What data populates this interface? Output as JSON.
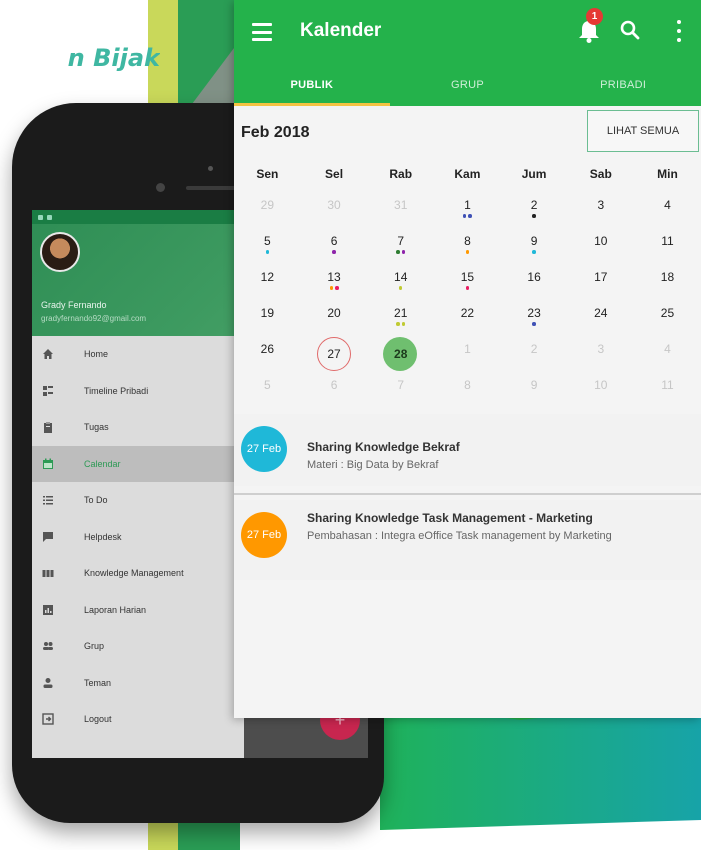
{
  "headline": "n Bijak",
  "colors": {
    "brand_green": "#24b24b",
    "tab_indicator": "#f5c342",
    "event_blue": "#1fb8d8",
    "event_orange": "#ff9800",
    "headline_teal": "#3fb7a2"
  },
  "phone": {
    "drawer": {
      "user_name": "Grady Fernando",
      "user_email": "gradyfernando92@gmail.com",
      "items": [
        {
          "label": "Home",
          "icon": "home-icon"
        },
        {
          "label": "Timeline Pribadi",
          "icon": "timeline-icon"
        },
        {
          "label": "Tugas",
          "icon": "clipboard-icon"
        },
        {
          "label": "Calendar",
          "icon": "calendar-icon",
          "active": true
        },
        {
          "label": "To Do",
          "icon": "checklist-icon"
        },
        {
          "label": "Helpdesk",
          "icon": "chat-icon"
        },
        {
          "label": "Knowledge Management",
          "icon": "books-icon"
        },
        {
          "label": "Laporan Harian",
          "icon": "report-icon"
        },
        {
          "label": "Grup",
          "icon": "group-icon"
        },
        {
          "label": "Teman",
          "icon": "person-icon"
        },
        {
          "label": "Logout",
          "icon": "logout-icon"
        }
      ]
    },
    "fab_symbol": "+"
  },
  "app": {
    "title": "Kalender",
    "notification_count": "1",
    "tabs": [
      {
        "label": "PUBLIK",
        "active": true
      },
      {
        "label": "GRUP",
        "active": false
      },
      {
        "label": "PRIBADI",
        "active": false
      }
    ],
    "month_label": "Feb 2018",
    "see_all_label": "LIHAT SEMUA",
    "weekdays": [
      "Sen",
      "Sel",
      "Rab",
      "Kam",
      "Jum",
      "Sab",
      "Min"
    ],
    "weeks": [
      [
        {
          "d": "29",
          "m": true
        },
        {
          "d": "30",
          "m": true
        },
        {
          "d": "31",
          "m": true
        },
        {
          "d": "1",
          "dots": [
            "#3f51b5",
            "#3f51b5"
          ]
        },
        {
          "d": "2",
          "dots": [
            "#222222"
          ]
        },
        {
          "d": "3"
        },
        {
          "d": "4"
        }
      ],
      [
        {
          "d": "5",
          "dots": [
            "#1fb8d8"
          ]
        },
        {
          "d": "6",
          "dots": [
            "#8e24aa"
          ]
        },
        {
          "d": "7",
          "dots": [
            "#2e7d32",
            "#8e24aa"
          ]
        },
        {
          "d": "8",
          "dots": [
            "#ff9800"
          ]
        },
        {
          "d": "9",
          "dots": [
            "#1fb8d8"
          ]
        },
        {
          "d": "10"
        },
        {
          "d": "11"
        }
      ],
      [
        {
          "d": "12"
        },
        {
          "d": "13",
          "dots": [
            "#ff9800",
            "#e91e63"
          ]
        },
        {
          "d": "14",
          "dots": [
            "#c0ca33"
          ]
        },
        {
          "d": "15",
          "dots": [
            "#e91e63"
          ]
        },
        {
          "d": "16"
        },
        {
          "d": "17"
        },
        {
          "d": "18"
        }
      ],
      [
        {
          "d": "19"
        },
        {
          "d": "20"
        },
        {
          "d": "21",
          "dots": [
            "#c0ca33",
            "#c0ca33"
          ]
        },
        {
          "d": "22"
        },
        {
          "d": "23",
          "dots": [
            "#3f51b5"
          ]
        },
        {
          "d": "24"
        },
        {
          "d": "25"
        }
      ],
      [
        {
          "d": "26"
        },
        {
          "d": "27",
          "today": true
        },
        {
          "d": "28",
          "selected": true
        },
        {
          "d": "1",
          "m": true
        },
        {
          "d": "2",
          "m": true
        },
        {
          "d": "3",
          "m": true
        },
        {
          "d": "4",
          "m": true
        }
      ],
      [
        {
          "d": "5",
          "m": true
        },
        {
          "d": "6",
          "m": true
        },
        {
          "d": "7",
          "m": true
        },
        {
          "d": "8",
          "m": true
        },
        {
          "d": "9",
          "m": true
        },
        {
          "d": "10",
          "m": true
        },
        {
          "d": "11",
          "m": true
        }
      ]
    ],
    "events": [
      {
        "date": "27 Feb",
        "color": "#1fb8d8",
        "title": "Sharing Knowledge Bekraf",
        "desc": "Materi : Big Data by Bekraf"
      },
      {
        "date": "27 Feb",
        "color": "#ff9800",
        "title": "Sharing Knowledge Task Management - Marketing",
        "desc": "Pembahasan : Integra eOffice Task management by Marketing"
      }
    ]
  }
}
